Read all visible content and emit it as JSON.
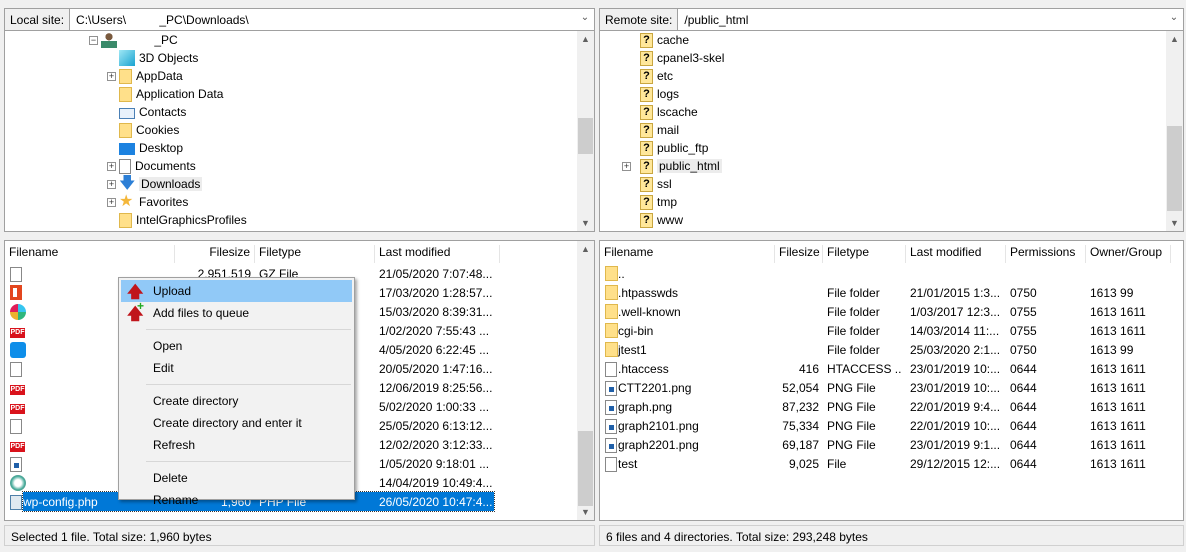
{
  "local": {
    "label": "Local site:",
    "path": "C:\\Users\\          _PC\\Downloads\\",
    "tree": [
      {
        "label": "          _PC",
        "icon": "user-icon",
        "expander": "minus"
      },
      {
        "label": "3D Objects",
        "icon": "3d-objects-icon"
      },
      {
        "label": "AppData",
        "icon": "folder-icon",
        "expander": "plus"
      },
      {
        "label": "Application Data",
        "icon": "folder-icon"
      },
      {
        "label": "Contacts",
        "icon": "contacts-icon"
      },
      {
        "label": "Cookies",
        "icon": "folder-icon"
      },
      {
        "label": "Desktop",
        "icon": "desktop-icon"
      },
      {
        "label": "Documents",
        "icon": "documents-icon",
        "expander": "plus"
      },
      {
        "label": "Downloads",
        "icon": "download-arrow-icon",
        "expander": "plus",
        "selected": true
      },
      {
        "label": "Favorites",
        "icon": "star-icon",
        "expander": "plus"
      },
      {
        "label": "IntelGraphicsProfiles",
        "icon": "folder-icon"
      }
    ],
    "columns": [
      "Filename",
      "Filesize",
      "Filetype",
      "Last modified"
    ],
    "rows": [
      {
        "name": "",
        "size": "2,951,519",
        "type": "GZ File",
        "modified": "21/05/2020 7:07:48...",
        "icon": "file-icon"
      },
      {
        "name": "",
        "size": "",
        "type": "",
        "modified": "17/03/2020 1:28:57...",
        "icon": "office-icon"
      },
      {
        "name": "",
        "size": "",
        "type": "",
        "modified": "15/03/2020 8:39:31...",
        "icon": "slack-icon"
      },
      {
        "name": "",
        "size": "",
        "type": "",
        "modified": "1/02/2020 7:55:43 ...",
        "icon": "pdf-icon"
      },
      {
        "name": "",
        "size": "",
        "type": "",
        "modified": "4/05/2020 6:22:45 ...",
        "icon": "teamviewer-icon"
      },
      {
        "name": "",
        "size": "",
        "type": "",
        "modified": "20/05/2020 1:47:16...",
        "icon": "file-icon"
      },
      {
        "name": "",
        "size": "",
        "type": "",
        "modified": "12/06/2019 8:25:56...",
        "icon": "pdf-icon"
      },
      {
        "name": "",
        "size": "",
        "type": "",
        "modified": "5/02/2020 1:00:33 ...",
        "icon": "pdf-icon"
      },
      {
        "name": "",
        "size": "",
        "type": "",
        "modified": "25/05/2020 6:13:12...",
        "icon": "file-icon"
      },
      {
        "name": "",
        "size": "",
        "type": "",
        "modified": "12/02/2020 3:12:33...",
        "icon": "pdf-icon"
      },
      {
        "name": "",
        "size": "",
        "type": "",
        "modified": "1/05/2020 9:18:01 ...",
        "icon": "image-file-icon"
      },
      {
        "name": "",
        "size": "",
        "type": "",
        "modified": "14/04/2019 10:49:4...",
        "icon": "installer-icon"
      },
      {
        "name": "wp-config.php",
        "size": "1,960",
        "type": "PHP File",
        "modified": "26/05/2020 10:47:4...",
        "icon": "php-file-icon",
        "selected": true
      }
    ],
    "status": "Selected 1 file. Total size: 1,960 bytes"
  },
  "remote": {
    "label": "Remote site:",
    "path": "/public_html",
    "tree": [
      {
        "label": "cache"
      },
      {
        "label": "cpanel3-skel"
      },
      {
        "label": "etc"
      },
      {
        "label": "logs"
      },
      {
        "label": "lscache"
      },
      {
        "label": "mail"
      },
      {
        "label": "public_ftp"
      },
      {
        "label": "public_html",
        "expander": "plus",
        "selected": true
      },
      {
        "label": "ssl"
      },
      {
        "label": "tmp"
      },
      {
        "label": "www"
      }
    ],
    "columns": [
      "Filename",
      "Filesize",
      "Filetype",
      "Last modified",
      "Permissions",
      "Owner/Group"
    ],
    "rows": [
      {
        "name": "..",
        "size": "",
        "type": "",
        "modified": "",
        "perm": "",
        "owner": "",
        "icon": "folder-icon"
      },
      {
        "name": ".htpasswds",
        "size": "",
        "type": "File folder",
        "modified": "21/01/2015 1:3...",
        "perm": "0750",
        "owner": "1613 99",
        "icon": "folder-icon"
      },
      {
        "name": ".well-known",
        "size": "",
        "type": "File folder",
        "modified": "1/03/2017 12:3...",
        "perm": "0755",
        "owner": "1613 1611",
        "icon": "folder-icon"
      },
      {
        "name": "cgi-bin",
        "size": "",
        "type": "File folder",
        "modified": "14/03/2014 11:...",
        "perm": "0755",
        "owner": "1613 1611",
        "icon": "folder-icon"
      },
      {
        "name": "jtest1",
        "size": "",
        "type": "File folder",
        "modified": "25/03/2020 2:1...",
        "perm": "0750",
        "owner": "1613 99",
        "icon": "folder-icon"
      },
      {
        "name": ".htaccess",
        "size": "416",
        "type": "HTACCESS ...",
        "modified": "23/01/2019 10:...",
        "perm": "0644",
        "owner": "1613 1611",
        "icon": "file-icon"
      },
      {
        "name": "CTT2201.png",
        "size": "52,054",
        "type": "PNG File",
        "modified": "23/01/2019 10:...",
        "perm": "0644",
        "owner": "1613 1611",
        "icon": "png-icon"
      },
      {
        "name": "graph.png",
        "size": "87,232",
        "type": "PNG File",
        "modified": "22/01/2019 9:4...",
        "perm": "0644",
        "owner": "1613 1611",
        "icon": "png-icon"
      },
      {
        "name": "graph2101.png",
        "size": "75,334",
        "type": "PNG File",
        "modified": "22/01/2019 10:...",
        "perm": "0644",
        "owner": "1613 1611",
        "icon": "png-icon"
      },
      {
        "name": "graph2201.png",
        "size": "69,187",
        "type": "PNG File",
        "modified": "23/01/2019 9:1...",
        "perm": "0644",
        "owner": "1613 1611",
        "icon": "png-icon"
      },
      {
        "name": "test",
        "size": "9,025",
        "type": "File",
        "modified": "29/12/2015 12:...",
        "perm": "0644",
        "owner": "1613 1611",
        "icon": "file-icon"
      }
    ],
    "status": "6 files and 4 directories. Total size: 293,248 bytes"
  },
  "context_menu": {
    "items": [
      {
        "label": "Upload",
        "icon": "upload-arrow-icon",
        "highlighted": true
      },
      {
        "label": "Add files to queue",
        "icon": "add-to-queue-icon"
      },
      {
        "separator": true
      },
      {
        "label": "Open"
      },
      {
        "label": "Edit"
      },
      {
        "separator": true
      },
      {
        "label": "Create directory"
      },
      {
        "label": "Create directory and enter it"
      },
      {
        "label": "Refresh"
      },
      {
        "separator": true
      },
      {
        "label": "Delete"
      },
      {
        "label": "Rename"
      }
    ]
  },
  "colors": {
    "selection": "#0078d7",
    "menu_highlight": "#91c9f7"
  }
}
